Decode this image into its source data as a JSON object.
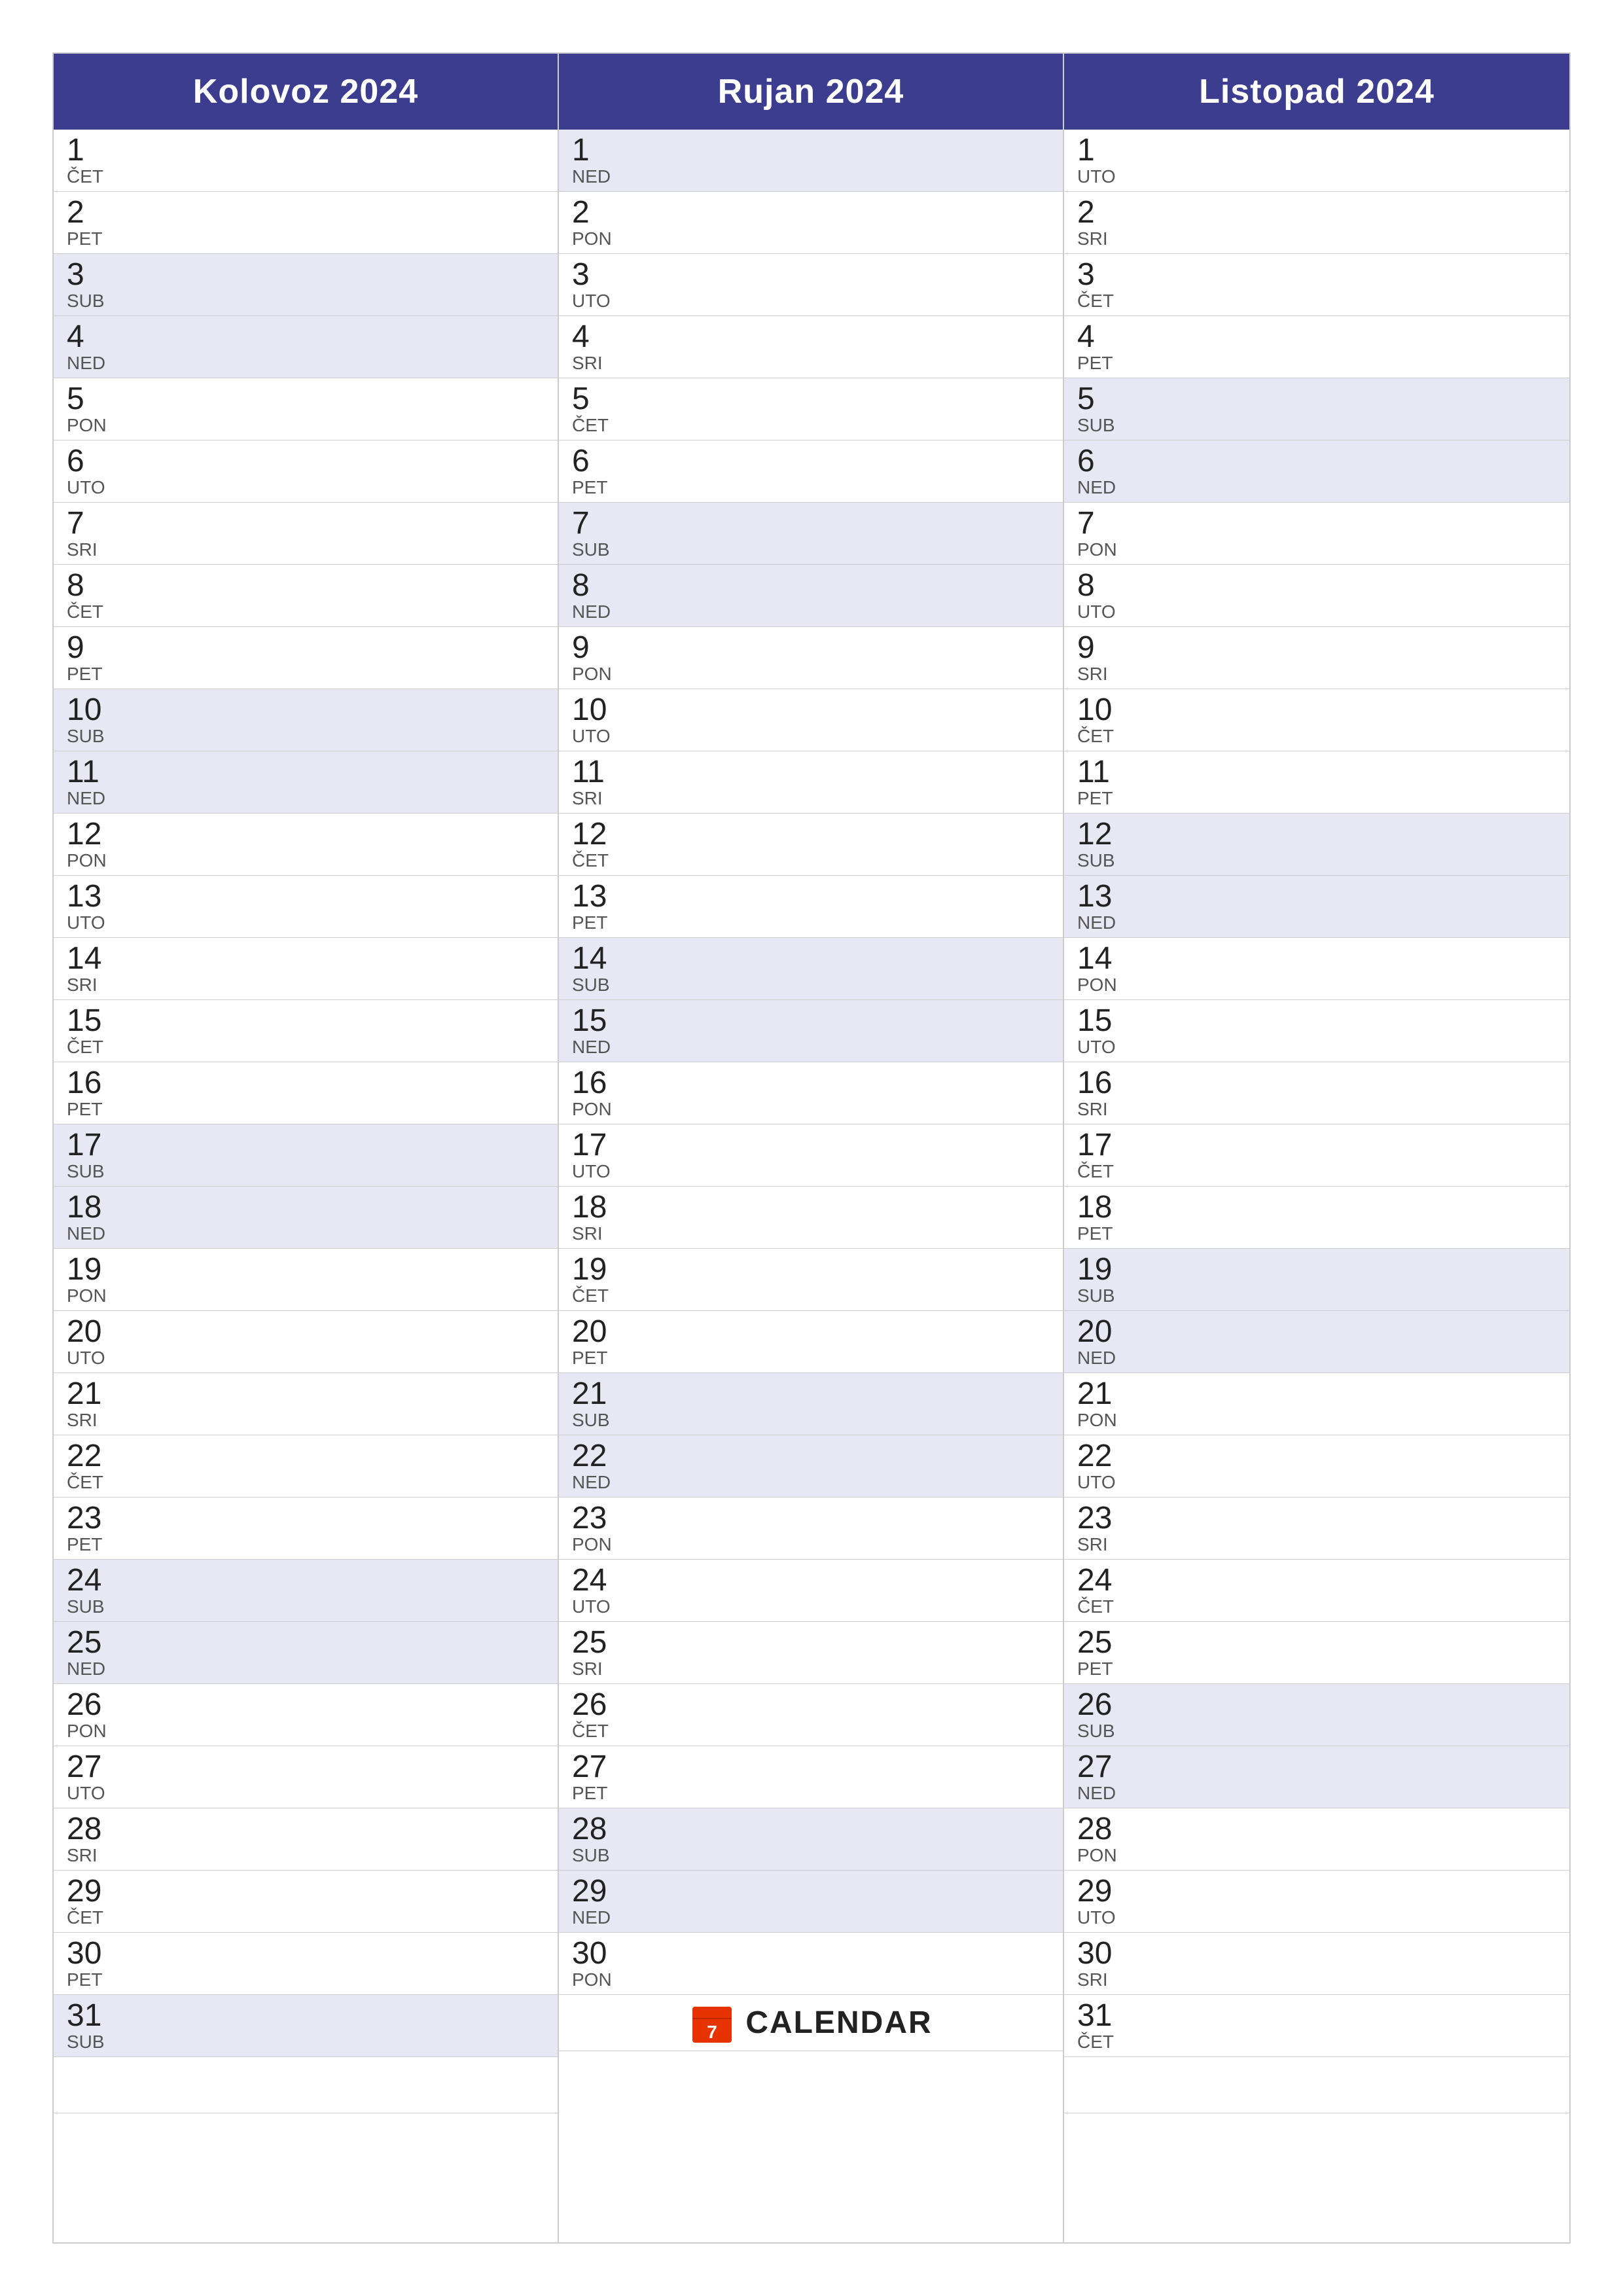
{
  "months": [
    {
      "name": "Kolovoz 2024",
      "days": [
        {
          "num": "1",
          "name": "ČET",
          "weekend": false
        },
        {
          "num": "2",
          "name": "PET",
          "weekend": false
        },
        {
          "num": "3",
          "name": "SUB",
          "weekend": true
        },
        {
          "num": "4",
          "name": "NED",
          "weekend": true
        },
        {
          "num": "5",
          "name": "PON",
          "weekend": false
        },
        {
          "num": "6",
          "name": "UTO",
          "weekend": false
        },
        {
          "num": "7",
          "name": "SRI",
          "weekend": false
        },
        {
          "num": "8",
          "name": "ČET",
          "weekend": false
        },
        {
          "num": "9",
          "name": "PET",
          "weekend": false
        },
        {
          "num": "10",
          "name": "SUB",
          "weekend": true
        },
        {
          "num": "11",
          "name": "NED",
          "weekend": true
        },
        {
          "num": "12",
          "name": "PON",
          "weekend": false
        },
        {
          "num": "13",
          "name": "UTO",
          "weekend": false
        },
        {
          "num": "14",
          "name": "SRI",
          "weekend": false
        },
        {
          "num": "15",
          "name": "ČET",
          "weekend": false
        },
        {
          "num": "16",
          "name": "PET",
          "weekend": false
        },
        {
          "num": "17",
          "name": "SUB",
          "weekend": true
        },
        {
          "num": "18",
          "name": "NED",
          "weekend": true
        },
        {
          "num": "19",
          "name": "PON",
          "weekend": false
        },
        {
          "num": "20",
          "name": "UTO",
          "weekend": false
        },
        {
          "num": "21",
          "name": "SRI",
          "weekend": false
        },
        {
          "num": "22",
          "name": "ČET",
          "weekend": false
        },
        {
          "num": "23",
          "name": "PET",
          "weekend": false
        },
        {
          "num": "24",
          "name": "SUB",
          "weekend": true
        },
        {
          "num": "25",
          "name": "NED",
          "weekend": true
        },
        {
          "num": "26",
          "name": "PON",
          "weekend": false
        },
        {
          "num": "27",
          "name": "UTO",
          "weekend": false
        },
        {
          "num": "28",
          "name": "SRI",
          "weekend": false
        },
        {
          "num": "29",
          "name": "ČET",
          "weekend": false
        },
        {
          "num": "30",
          "name": "PET",
          "weekend": false
        },
        {
          "num": "31",
          "name": "SUB",
          "weekend": true
        }
      ]
    },
    {
      "name": "Rujan 2024",
      "days": [
        {
          "num": "1",
          "name": "NED",
          "weekend": true
        },
        {
          "num": "2",
          "name": "PON",
          "weekend": false
        },
        {
          "num": "3",
          "name": "UTO",
          "weekend": false
        },
        {
          "num": "4",
          "name": "SRI",
          "weekend": false
        },
        {
          "num": "5",
          "name": "ČET",
          "weekend": false
        },
        {
          "num": "6",
          "name": "PET",
          "weekend": false
        },
        {
          "num": "7",
          "name": "SUB",
          "weekend": true
        },
        {
          "num": "8",
          "name": "NED",
          "weekend": true
        },
        {
          "num": "9",
          "name": "PON",
          "weekend": false
        },
        {
          "num": "10",
          "name": "UTO",
          "weekend": false
        },
        {
          "num": "11",
          "name": "SRI",
          "weekend": false
        },
        {
          "num": "12",
          "name": "ČET",
          "weekend": false
        },
        {
          "num": "13",
          "name": "PET",
          "weekend": false
        },
        {
          "num": "14",
          "name": "SUB",
          "weekend": true
        },
        {
          "num": "15",
          "name": "NED",
          "weekend": true
        },
        {
          "num": "16",
          "name": "PON",
          "weekend": false
        },
        {
          "num": "17",
          "name": "UTO",
          "weekend": false
        },
        {
          "num": "18",
          "name": "SRI",
          "weekend": false
        },
        {
          "num": "19",
          "name": "ČET",
          "weekend": false
        },
        {
          "num": "20",
          "name": "PET",
          "weekend": false
        },
        {
          "num": "21",
          "name": "SUB",
          "weekend": true
        },
        {
          "num": "22",
          "name": "NED",
          "weekend": true
        },
        {
          "num": "23",
          "name": "PON",
          "weekend": false
        },
        {
          "num": "24",
          "name": "UTO",
          "weekend": false
        },
        {
          "num": "25",
          "name": "SRI",
          "weekend": false
        },
        {
          "num": "26",
          "name": "ČET",
          "weekend": false
        },
        {
          "num": "27",
          "name": "PET",
          "weekend": false
        },
        {
          "num": "28",
          "name": "SUB",
          "weekend": true
        },
        {
          "num": "29",
          "name": "NED",
          "weekend": true
        },
        {
          "num": "30",
          "name": "PON",
          "weekend": false
        }
      ],
      "has_logo": true
    },
    {
      "name": "Listopad 2024",
      "days": [
        {
          "num": "1",
          "name": "UTO",
          "weekend": false
        },
        {
          "num": "2",
          "name": "SRI",
          "weekend": false
        },
        {
          "num": "3",
          "name": "ČET",
          "weekend": false
        },
        {
          "num": "4",
          "name": "PET",
          "weekend": false
        },
        {
          "num": "5",
          "name": "SUB",
          "weekend": true
        },
        {
          "num": "6",
          "name": "NED",
          "weekend": true
        },
        {
          "num": "7",
          "name": "PON",
          "weekend": false
        },
        {
          "num": "8",
          "name": "UTO",
          "weekend": false
        },
        {
          "num": "9",
          "name": "SRI",
          "weekend": false
        },
        {
          "num": "10",
          "name": "ČET",
          "weekend": false
        },
        {
          "num": "11",
          "name": "PET",
          "weekend": false
        },
        {
          "num": "12",
          "name": "SUB",
          "weekend": true
        },
        {
          "num": "13",
          "name": "NED",
          "weekend": true
        },
        {
          "num": "14",
          "name": "PON",
          "weekend": false
        },
        {
          "num": "15",
          "name": "UTO",
          "weekend": false
        },
        {
          "num": "16",
          "name": "SRI",
          "weekend": false
        },
        {
          "num": "17",
          "name": "ČET",
          "weekend": false
        },
        {
          "num": "18",
          "name": "PET",
          "weekend": false
        },
        {
          "num": "19",
          "name": "SUB",
          "weekend": true
        },
        {
          "num": "20",
          "name": "NED",
          "weekend": true
        },
        {
          "num": "21",
          "name": "PON",
          "weekend": false
        },
        {
          "num": "22",
          "name": "UTO",
          "weekend": false
        },
        {
          "num": "23",
          "name": "SRI",
          "weekend": false
        },
        {
          "num": "24",
          "name": "ČET",
          "weekend": false
        },
        {
          "num": "25",
          "name": "PET",
          "weekend": false
        },
        {
          "num": "26",
          "name": "SUB",
          "weekend": true
        },
        {
          "num": "27",
          "name": "NED",
          "weekend": true
        },
        {
          "num": "28",
          "name": "PON",
          "weekend": false
        },
        {
          "num": "29",
          "name": "UTO",
          "weekend": false
        },
        {
          "num": "30",
          "name": "SRI",
          "weekend": false
        },
        {
          "num": "31",
          "name": "ČET",
          "weekend": false
        }
      ]
    }
  ],
  "logo": {
    "text": "CALENDAR",
    "icon_color": "#e63300"
  }
}
